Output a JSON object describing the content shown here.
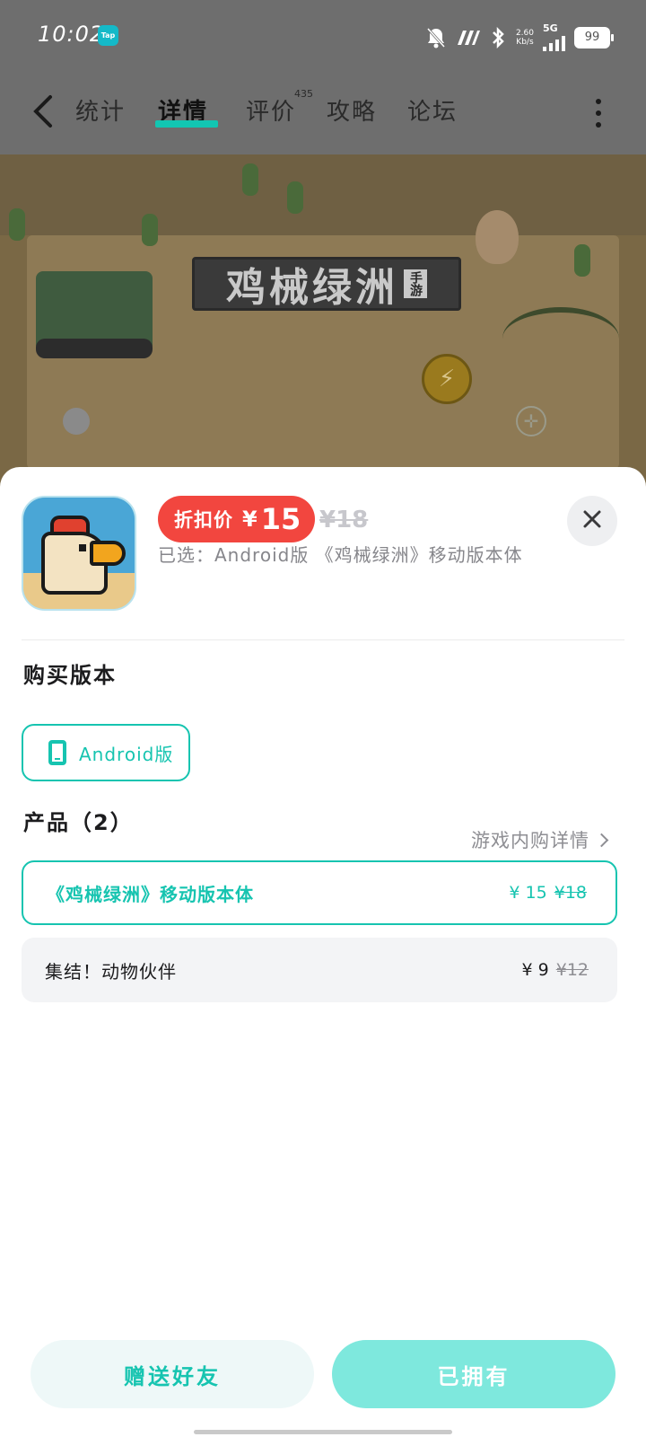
{
  "status_bar": {
    "time": "10:02",
    "app_badge": "Tap",
    "net_speed_value": "2.60",
    "net_speed_unit": "Kb/s",
    "network": "5G",
    "battery": "99"
  },
  "nav": {
    "tabs": [
      {
        "label": "统计"
      },
      {
        "label": "详情"
      },
      {
        "label": "评价"
      },
      {
        "label": "攻略"
      },
      {
        "label": "论坛"
      }
    ],
    "active_tab": "详情",
    "review_count": "435"
  },
  "banner": {
    "game_logo": "鸡械绿洲",
    "logo_tag": "手游"
  },
  "sheet": {
    "price_label": "折扣价",
    "currency": "¥",
    "price": "15",
    "original_price": "¥18",
    "selected_text": "已选：Android版 《鸡械绿洲》移动版本体",
    "version_section_title": "购买版本",
    "version_option": "Android版",
    "products_title": "产品（2）",
    "products_detail_link": "游戏内购详情",
    "products": [
      {
        "name": "《鸡械绿洲》移动版本体",
        "price": "¥ 15",
        "original": "¥18",
        "selected": true
      },
      {
        "name": "集结！动物伙伴",
        "price": "¥ 9",
        "original": "¥12",
        "selected": false
      }
    ],
    "gift_button": "赠送好友",
    "owned_button": "已拥有"
  },
  "colors": {
    "accent": "#16c4b0",
    "price_red": "#f2463f",
    "owned_button_bg": "#7ee8dd"
  }
}
